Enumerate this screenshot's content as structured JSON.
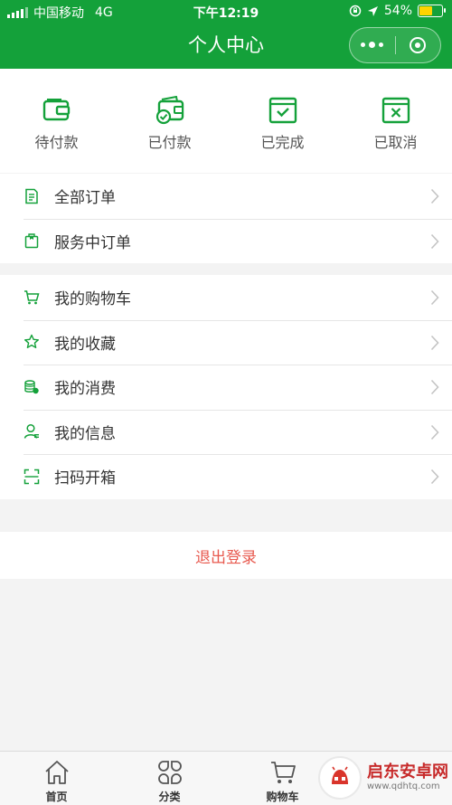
{
  "status_bar": {
    "carrier": "中国移动",
    "network": "4G",
    "time": "下午12:19",
    "battery_text": "54%",
    "battery_level": 0.54,
    "icons": [
      "signal-icon",
      "orientation-lock-icon",
      "location-arrow-icon",
      "battery-icon"
    ]
  },
  "nav": {
    "title": "个人中心",
    "more_icon": "more-dots-icon",
    "close_icon": "target-circle-icon"
  },
  "orders": [
    {
      "label": "待付款",
      "icon": "wallet-icon"
    },
    {
      "label": "已付款",
      "icon": "wallet-check-icon"
    },
    {
      "label": "已完成",
      "icon": "box-check-icon"
    },
    {
      "label": "已取消",
      "icon": "box-x-icon"
    }
  ],
  "menu_group_1": [
    {
      "label": "全部订单",
      "icon": "document-list-icon"
    },
    {
      "label": "服务中订单",
      "icon": "shopping-bag-icon"
    }
  ],
  "menu_group_2": [
    {
      "label": "我的购物车",
      "icon": "cart-icon"
    },
    {
      "label": "我的收藏",
      "icon": "star-icon"
    },
    {
      "label": "我的消费",
      "icon": "coins-icon"
    },
    {
      "label": "我的信息",
      "icon": "user-icon"
    },
    {
      "label": "扫码开箱",
      "icon": "scan-icon"
    }
  ],
  "logout_label": "退出登录",
  "tabbar": [
    {
      "label": "首页",
      "icon": "home-icon"
    },
    {
      "label": "分类",
      "icon": "category-icon"
    },
    {
      "label": "购物车",
      "icon": "cart-icon"
    }
  ],
  "watermark": {
    "title": "启东安卓网",
    "url": "www.qdhtq.com"
  },
  "colors": {
    "brand_green": "#14a13a",
    "logout_red": "#e85a4f",
    "battery_yellow": "#ffd400"
  }
}
